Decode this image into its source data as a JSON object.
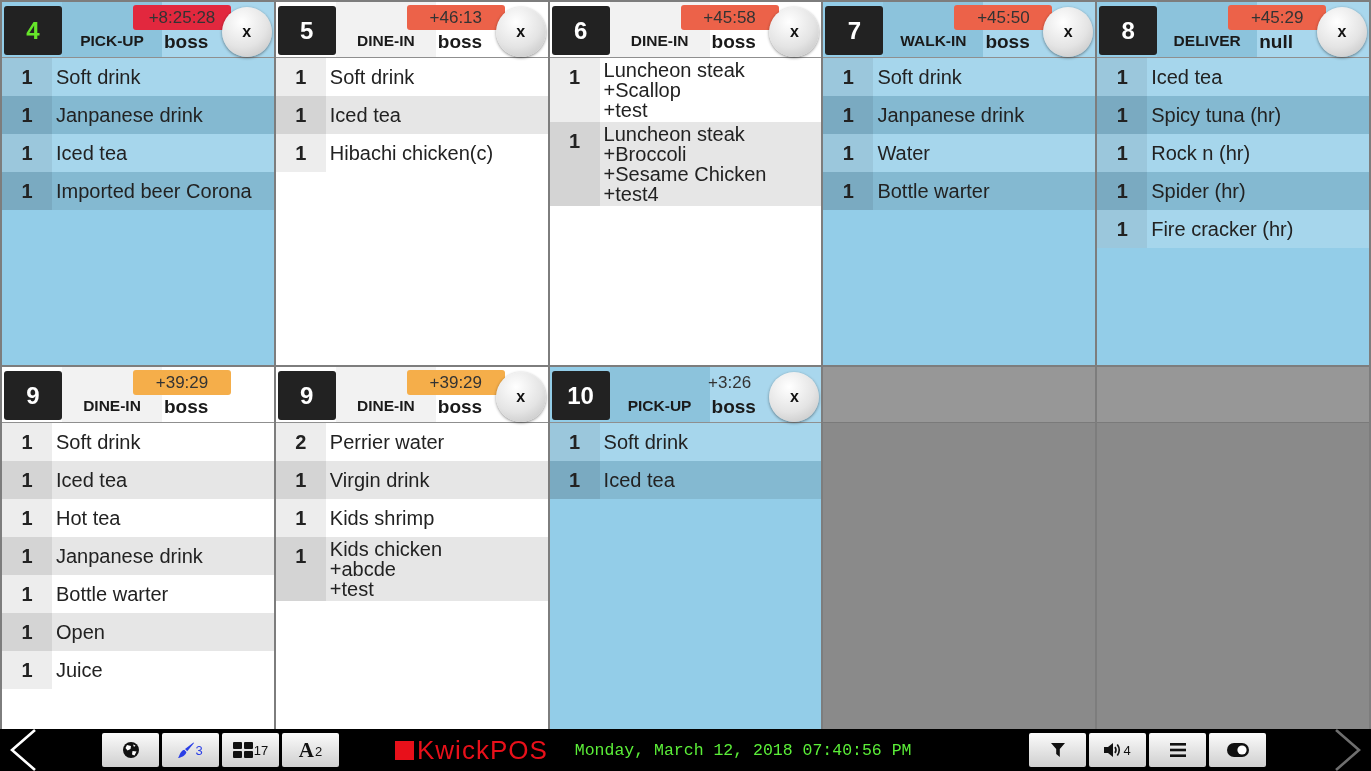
{
  "tickets": [
    {
      "kind": "order",
      "color": "#93cde8",
      "number": {
        "text": "4",
        "color": "#66e62a"
      },
      "type": "PICK-UP",
      "user": "boss",
      "timer": {
        "text": "+8:25:28",
        "color": "#e2283e"
      },
      "close": "x",
      "items": [
        {
          "qty": "1",
          "name": "Soft drink"
        },
        {
          "qty": "1",
          "name": "Janpanese drink"
        },
        {
          "qty": "1",
          "name": "Iced tea"
        },
        {
          "qty": "1",
          "name": "Imported beer Corona"
        }
      ]
    },
    {
      "kind": "order",
      "color": "#ffffff",
      "number": {
        "text": "5",
        "color": "#ffffff"
      },
      "type": "DINE-IN",
      "user": "boss",
      "timer": {
        "text": "+46:13",
        "color": "#ec6249"
      },
      "close": "x",
      "items": [
        {
          "qty": "1",
          "name": "Soft drink"
        },
        {
          "qty": "1",
          "name": "Iced tea"
        },
        {
          "qty": "1",
          "name": "Hibachi chicken(c)"
        }
      ]
    },
    {
      "kind": "order",
      "color": "#ffffff",
      "number": {
        "text": "6",
        "color": "#ffffff"
      },
      "type": "DINE-IN",
      "user": "boss",
      "timer": {
        "text": "+45:58",
        "color": "#ec6249"
      },
      "close": "x",
      "items": [
        {
          "qty": "1",
          "name": "Luncheon steak",
          "modifiers": [
            "+Scallop",
            "+test"
          ]
        },
        {
          "qty": "1",
          "name": "Luncheon steak",
          "modifiers": [
            "+Broccoli",
            "+Sesame Chicken",
            "+test4"
          ]
        }
      ]
    },
    {
      "kind": "order",
      "color": "#93cde8",
      "number": {
        "text": "7",
        "color": "#ffffff"
      },
      "type": "WALK-IN",
      "user": "boss",
      "timer": {
        "text": "+45:50",
        "color": "#ec6249"
      },
      "close": "x",
      "items": [
        {
          "qty": "1",
          "name": "Soft drink"
        },
        {
          "qty": "1",
          "name": "Janpanese drink"
        },
        {
          "qty": "1",
          "name": "Water"
        },
        {
          "qty": "1",
          "name": "Bottle warter"
        }
      ]
    },
    {
      "kind": "order",
      "color": "#93cde8",
      "number": {
        "text": "8",
        "color": "#ffffff"
      },
      "type": "DELIVER",
      "user": "null",
      "timer": {
        "text": "+45:29",
        "color": "#ec6249"
      },
      "close": "x",
      "items": [
        {
          "qty": "1",
          "name": "Iced tea"
        },
        {
          "qty": "1",
          "name": "Spicy tuna (hr)"
        },
        {
          "qty": "1",
          "name": "Rock n (hr)"
        },
        {
          "qty": "1",
          "name": "Spider (hr)"
        },
        {
          "qty": "1",
          "name": "Fire cracker (hr)"
        }
      ]
    },
    {
      "kind": "order",
      "color": "#ffffff",
      "number": {
        "text": "9",
        "color": "#ffffff"
      },
      "type": "DINE-IN",
      "user": "boss",
      "timer": {
        "text": "+39:29",
        "color": "#f5ae4a"
      },
      "items": [
        {
          "qty": "1",
          "name": "Soft drink"
        },
        {
          "qty": "1",
          "name": "Iced tea"
        },
        {
          "qty": "1",
          "name": "Hot tea"
        },
        {
          "qty": "1",
          "name": "Janpanese drink"
        },
        {
          "qty": "1",
          "name": "Bottle warter"
        },
        {
          "qty": "1",
          "name": "Open"
        },
        {
          "qty": "1",
          "name": "Juice"
        }
      ]
    },
    {
      "kind": "order",
      "color": "#ffffff",
      "number": {
        "text": "9",
        "color": "#ffffff"
      },
      "type": "DINE-IN",
      "user": "boss",
      "timer": {
        "text": "+39:29",
        "color": "#f5ae4a"
      },
      "close": "x",
      "items": [
        {
          "qty": "2",
          "name": "Perrier water"
        },
        {
          "qty": "1",
          "name": "Virgin drink"
        },
        {
          "qty": "1",
          "name": "Kids shrimp"
        },
        {
          "qty": "1",
          "name": "Kids chicken",
          "modifiers": [
            "+abcde",
            "+test"
          ]
        }
      ]
    },
    {
      "kind": "order",
      "color": "#93cde8",
      "number": {
        "text": "10",
        "color": "#ffffff"
      },
      "type": "PICK-UP",
      "user": "boss",
      "timer": {
        "text": "+3:26"
      },
      "close": "x",
      "items": [
        {
          "qty": "1",
          "name": "Soft drink"
        },
        {
          "qty": "1",
          "name": "Iced tea"
        }
      ]
    },
    {
      "kind": "empty"
    },
    {
      "kind": "empty"
    }
  ],
  "toolbar": {
    "prev": {
      "disabled": false
    },
    "left_buttons": [
      {
        "kind": "icon"
      },
      {
        "kind": "icon",
        "badge": "3"
      },
      {
        "kind": "icon",
        "badge": "17"
      },
      {
        "kind": "letter",
        "label": "A",
        "badge": "2"
      }
    ],
    "logo": "KwickPOS",
    "datetime": "Monday, March 12, 2018 07:40:56 PM",
    "right_buttons": [
      {
        "kind": "icon"
      },
      {
        "kind": "icon",
        "badge": "4"
      },
      {
        "kind": "icon"
      },
      {
        "kind": "icon"
      }
    ],
    "next": {
      "disabled": true
    }
  }
}
